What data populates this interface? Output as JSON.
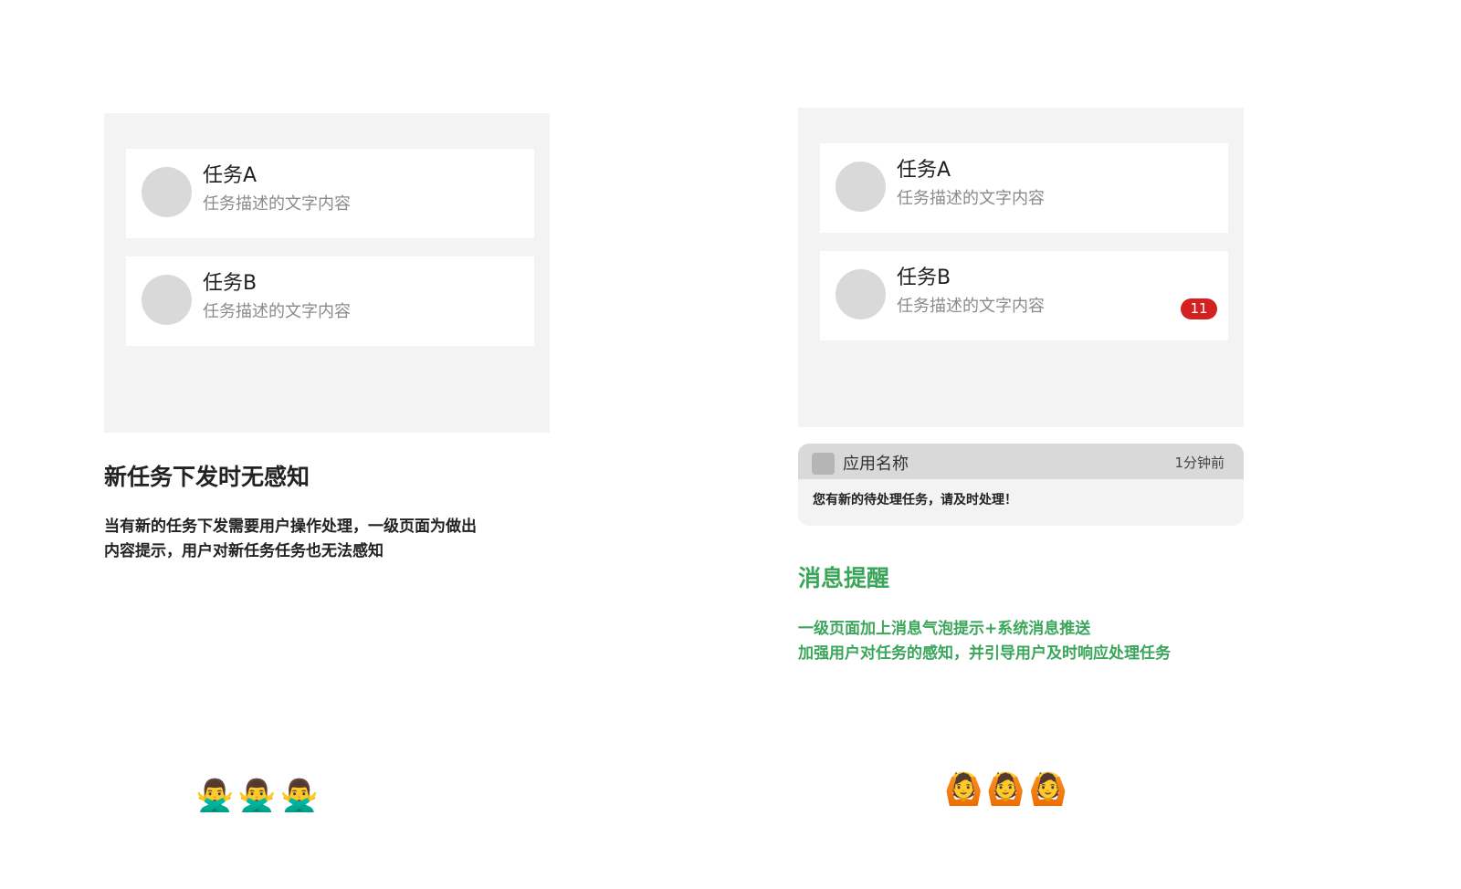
{
  "left": {
    "tasks": [
      {
        "title": "任务A",
        "desc": "任务描述的文字内容"
      },
      {
        "title": "任务B",
        "desc": "任务描述的文字内容"
      }
    ],
    "heading": "新任务下发时无感知",
    "description_lines": [
      "当有新的任务下发需要用户操作处理，一级页面为做出",
      "内容提示，用户对新任务任务也无法感知"
    ],
    "emoji": "🙅‍♂️🙅‍♂️🙅‍♂️"
  },
  "right": {
    "tasks": [
      {
        "title": "任务A",
        "desc": "任务描述的文字内容"
      },
      {
        "title": "任务B",
        "desc": "任务描述的文字内容",
        "badge": "11"
      }
    ],
    "notification": {
      "app_name": "应用名称",
      "time": "1分钟前",
      "message": "您有新的待处理任务，请及时处理！"
    },
    "heading": "消息提醒",
    "description_lines": [
      "一级页面加上消息气泡提示+系统消息推送",
      "加强用户对任务的感知，并引导用户及时响应处理任务"
    ],
    "emoji": "🙆🙆🙆"
  },
  "colors": {
    "panel_bg": "#f3f3f3",
    "avatar": "#d9d9d9",
    "badge": "#d32020",
    "accent_green": "#3aa65a"
  }
}
